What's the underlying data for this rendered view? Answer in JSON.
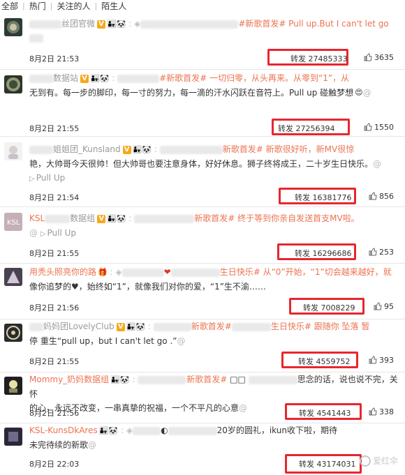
{
  "tabs": [
    "全部",
    "热门",
    "关注的人",
    "陌生人"
  ],
  "posts": [
    {
      "username": "丝团官微",
      "text_1": "#新歌首发# Pull up.But I can't let go",
      "time": "8月2日 21:53",
      "repost": "转发 27485333",
      "likes": "3635"
    },
    {
      "username": "数据站",
      "text_1": "#新歌首发# 一切归零，从头再来。从零到“1”，从",
      "text_2": "无到有。每一步的脚印，每一寸的努力，每一滴的汗水闪跃在音符上。Pull up 碰触梦想",
      "time": "8月2日 21:55",
      "repost": "转发 27256394",
      "likes": "1550"
    },
    {
      "username": "姐姐团_Kunsland",
      "text_1": "新歌首发# 新歌很好听，新MV很惊",
      "text_2": "艳，大帅哥今天很帅！但大帅哥也要注意身体，好好休息。狮子终将成王，二十岁生日快乐。",
      "pull": "Pull Up",
      "time": "8月2日 21:54",
      "repost": "转发 16381776",
      "likes": "856"
    },
    {
      "username": "KSL",
      "username_2": "数据组",
      "text_1": "新歌首发# 终于等到你亲自发送首支MV啦。",
      "pull": "Pull Up",
      "time": "8月2日 21:55",
      "repost": "转发 16296686",
      "likes": "253"
    },
    {
      "username": "用秃头照亮你的路",
      "text_1": "生日快乐# 从“0”开始，“1”切会越来越好，就",
      "text_2": "像你追梦的",
      "text_3": "，始终如“1”，就像我们对你的爱，“1”生不渝……",
      "time": "8月2日 21:56",
      "repost": "转发 7008229",
      "likes": "95"
    },
    {
      "username": "妈妈团LovelyClub",
      "text_1": "新歌首发#",
      "text_1b": "生日快乐# 跟随你 坠落 暂",
      "text_2": "停 重生“pull up，but I can't let go .”",
      "time": "8月2日 21:55",
      "repost": "转发 4559752",
      "likes": "393"
    },
    {
      "username": "Mommy_奶妈数据组",
      "text_1": "新歌首发#",
      "text_1b": "思念的话，说也说不完，关怀",
      "text_2": "的心，永远不改变，一串真挚的祝福，一个不平凡的心意",
      "time": "8月2日 21:56",
      "repost": "转发 4541443",
      "likes": "338"
    },
    {
      "username": "KSL-KunsDkAres",
      "text_1": "20岁的圆礼，ikun收下啦，期待",
      "text_2": "未完待续的新歌",
      "time": "8月2日 22:03",
      "repost": "转发 43174031",
      "likes": ""
    }
  ],
  "watermark": "爱红伞",
  "colors": {
    "highlight": "#e8262e",
    "tag": "#eb7350",
    "badge": "#f7a81c"
  }
}
